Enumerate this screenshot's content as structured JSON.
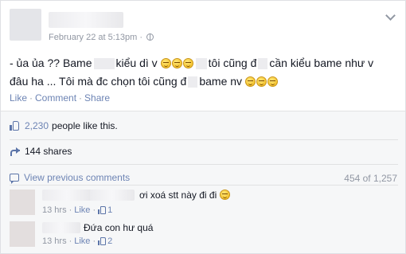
{
  "post": {
    "timestamp": "February 22 at 5:13pm",
    "separator": "·",
    "line1": {
      "a": "- ủa ủa ?? Bame",
      "b": "kiểu dì v",
      "c": "tôi cũng đ",
      "d": "cần kiểu bame như v"
    },
    "line2": {
      "a": "đâu ha ... Tôi mà đc chọn tôi cũng đ",
      "b": "bame nv"
    }
  },
  "actions": {
    "like": "Like",
    "comment": "Comment",
    "share": "Share",
    "dot": "·"
  },
  "ufi": {
    "likes_count": "2,230",
    "likes_suffix": "people like this.",
    "shares": "144 shares",
    "view_previous": "View previous comments",
    "comment_count": "454 of 1,257"
  },
  "comments": [
    {
      "text": "ơi xoá stt này đi đi",
      "time": "13 hrs",
      "like": "Like",
      "likes": "1",
      "dot": "·"
    },
    {
      "text": "Đứa con hư quá",
      "time": "13 hrs",
      "like": "Like",
      "likes": "2",
      "dot": "·"
    }
  ],
  "colors": {
    "link": "#6d84b4",
    "muted": "#9197a3",
    "icon": "#5b74a8"
  },
  "icons": [
    "globe-icon",
    "chevron-down-icon",
    "emoji-icon",
    "like-thumb-icon",
    "share-icon",
    "comment-bubble-icon"
  ]
}
